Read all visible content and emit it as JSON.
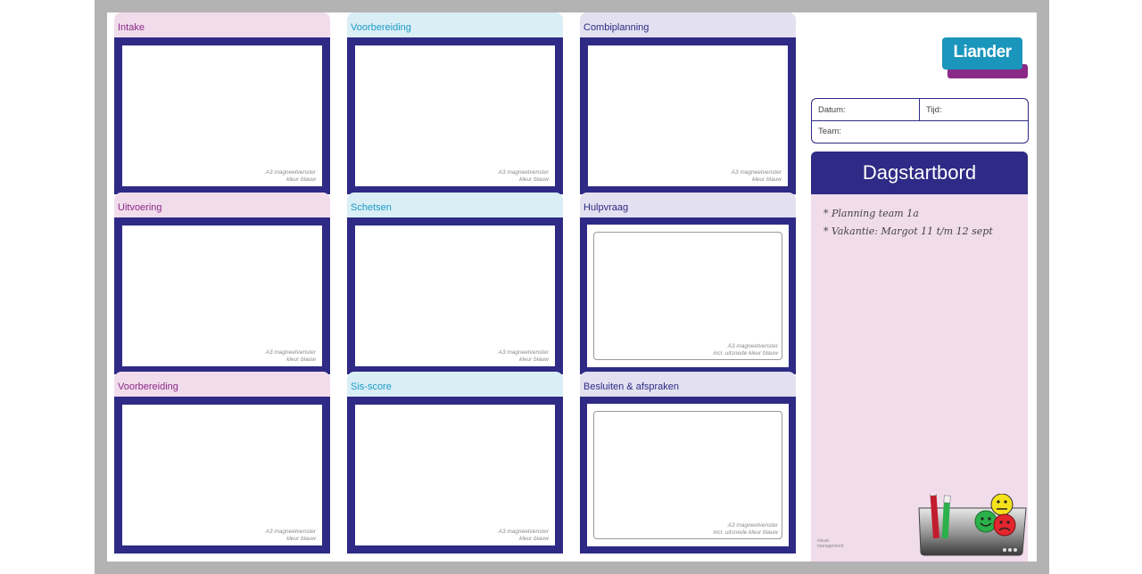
{
  "board": {
    "cells": [
      {
        "title": "Intake",
        "caption_line1": "A3 magneetvenster",
        "caption_line2": "kleur blauw"
      },
      {
        "title": "Voorbereiding",
        "caption_line1": "A3 magneetvenster",
        "caption_line2": "kleur blauw"
      },
      {
        "title": "Combiplanning",
        "caption_line1": "A3 magneetvenster",
        "caption_line2": "kleur blauw"
      },
      {
        "title": "Uitvoering",
        "caption_line1": "A3 magneetvenster",
        "caption_line2": "kleur blauw"
      },
      {
        "title": "Schetsen",
        "caption_line1": "A3 magneetvenster",
        "caption_line2": "kleur blauw"
      },
      {
        "title": "Hulpvraag",
        "caption_line1": "A3 magneetvenster",
        "caption_line2": "incl. uitsnede kleur blauw"
      },
      {
        "title": "Voorbereiding",
        "caption_line1": "A3 magneetvenster",
        "caption_line2": "kleur blauw"
      },
      {
        "title": "Sis-score",
        "caption_line1": "A3 magneetvenster",
        "caption_line2": "kleur blauw"
      },
      {
        "title": "Besluiten & afspraken",
        "caption_line1": "A3 magneetvenster",
        "caption_line2": "incl. uitsnede kleur blauw"
      }
    ]
  },
  "logo": {
    "text": "Liander"
  },
  "form": {
    "date_label": "Datum:",
    "time_label": "Tijd:",
    "team_label": "Team:"
  },
  "sidebar": {
    "title": "Dagstartbord",
    "notes": [
      "* Planning team 1a",
      "* Vakantie: Margot 11 t/m 12 sept"
    ]
  },
  "footer": {
    "brand_line1": "visual",
    "brand_line2": "management"
  },
  "colors": {
    "frame": "#b3b3b3",
    "navy": "#2e2a85",
    "pink": "#f1dcec",
    "light_blue": "#daeef5",
    "lavender": "#e3e0f1",
    "logo_teal": "#1a95bb",
    "logo_purple": "#8a2a86"
  },
  "icons": [
    "smiley-happy-icon",
    "smiley-neutral-icon",
    "smiley-sad-icon",
    "magnet-tray-icon"
  ]
}
